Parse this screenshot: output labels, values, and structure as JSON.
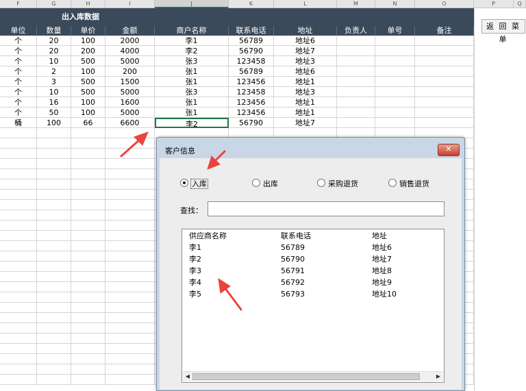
{
  "sheet": {
    "column_letters": [
      "F",
      "G",
      "H",
      "I",
      "J",
      "K",
      "L",
      "M",
      "N",
      "O",
      "P",
      "Q"
    ],
    "selected_column": "J",
    "band_title": "出入库数据",
    "headers": [
      "单位",
      "数量",
      "单价",
      "金额",
      "商户名称",
      "联系电话",
      "地址",
      "负责人",
      "单号",
      "备注"
    ],
    "rows": [
      [
        "个",
        "20",
        "100",
        "2000",
        "李1",
        "56789",
        "地址6",
        "",
        "",
        ""
      ],
      [
        "个",
        "20",
        "200",
        "4000",
        "李2",
        "56790",
        "地址7",
        "",
        "",
        ""
      ],
      [
        "个",
        "10",
        "500",
        "5000",
        "张3",
        "123458",
        "地址3",
        "",
        "",
        ""
      ],
      [
        "个",
        "2",
        "100",
        "200",
        "张1",
        "56789",
        "地址6",
        "",
        "",
        ""
      ],
      [
        "个",
        "3",
        "500",
        "1500",
        "张1",
        "123456",
        "地址1",
        "",
        "",
        ""
      ],
      [
        "个",
        "10",
        "500",
        "5000",
        "张3",
        "123458",
        "地址3",
        "",
        "",
        ""
      ],
      [
        "个",
        "16",
        "100",
        "1600",
        "张1",
        "123456",
        "地址1",
        "",
        "",
        ""
      ],
      [
        "个",
        "50",
        "100",
        "5000",
        "张1",
        "123456",
        "地址1",
        "",
        "",
        ""
      ],
      [
        "桶",
        "100",
        "66",
        "6600",
        "李2",
        "56790",
        "地址7",
        "",
        "",
        ""
      ]
    ],
    "selected_cell": {
      "row": 8,
      "col": 4
    },
    "back_button_label": "返 回 菜 单"
  },
  "dialog": {
    "title": "客户信息",
    "close_label": "✕",
    "radios": [
      {
        "label": "入库",
        "checked": true
      },
      {
        "label": "出库",
        "checked": false
      },
      {
        "label": "采购退货",
        "checked": false
      },
      {
        "label": "销售退货",
        "checked": false
      }
    ],
    "search_label": "查找：",
    "search_value": "",
    "list": {
      "columns": [
        "供应商名称",
        "联系电话",
        "地址"
      ],
      "rows": [
        [
          "李1",
          "56789",
          "地址6"
        ],
        [
          "李2",
          "56790",
          "地址7"
        ],
        [
          "李3",
          "56791",
          "地址8"
        ],
        [
          "李4",
          "56792",
          "地址9"
        ],
        [
          "李5",
          "56793",
          "地址10"
        ]
      ]
    }
  },
  "colors": {
    "header_band": "#3b4a5a",
    "selection": "#217346",
    "arrow": "#e8453c",
    "dialog_frame": "#c9d6e6"
  }
}
